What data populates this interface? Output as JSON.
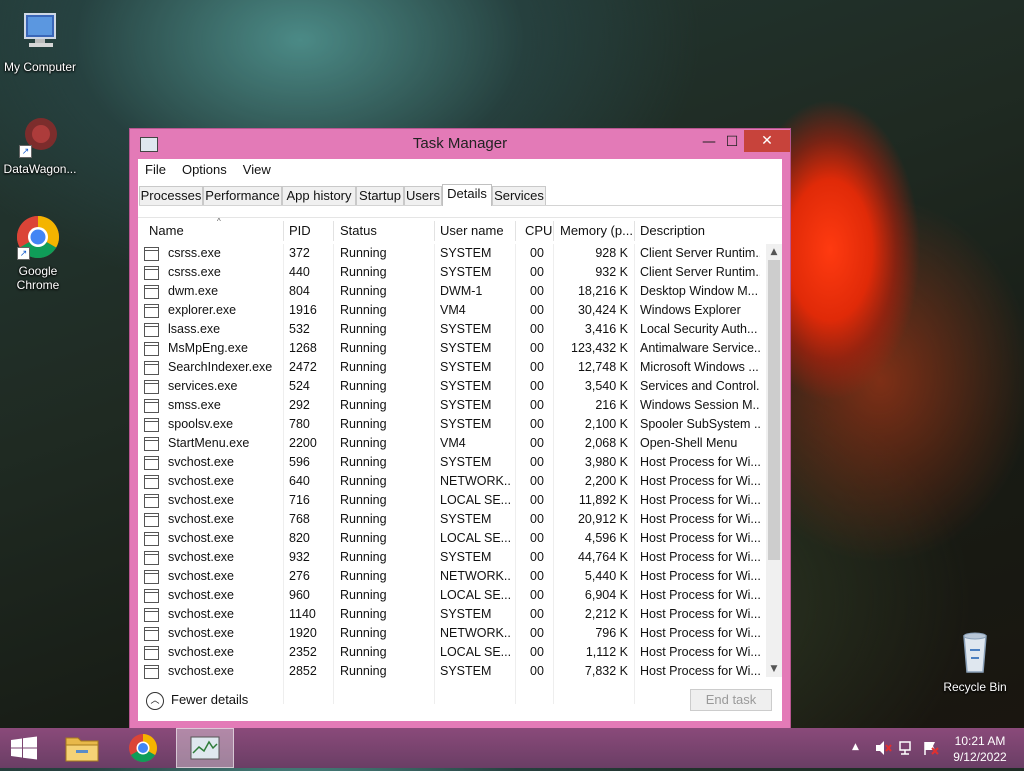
{
  "desktop": {
    "icons": [
      {
        "label": "My Computer"
      },
      {
        "label": "DataWagon..."
      },
      {
        "label": "Google Chrome"
      },
      {
        "label": "Recycle Bin"
      }
    ]
  },
  "window": {
    "title": "Task Manager",
    "controls": {
      "minimize": "—",
      "maximize": "☐",
      "close": "✕"
    },
    "menu": [
      "File",
      "Options",
      "View"
    ],
    "tabs": [
      "Processes",
      "Performance",
      "App history",
      "Startup",
      "Users",
      "Details",
      "Services"
    ],
    "active_tab": "Details",
    "columns": [
      "Name",
      "PID",
      "Status",
      "User name",
      "CPU",
      "Memory (p...",
      "Description"
    ],
    "rows": [
      {
        "name": "csrss.exe",
        "pid": "372",
        "status": "Running",
        "user": "SYSTEM",
        "cpu": "00",
        "mem": "928 K",
        "desc": "Client Server Runtim..."
      },
      {
        "name": "csrss.exe",
        "pid": "440",
        "status": "Running",
        "user": "SYSTEM",
        "cpu": "00",
        "mem": "932 K",
        "desc": "Client Server Runtim..."
      },
      {
        "name": "dwm.exe",
        "pid": "804",
        "status": "Running",
        "user": "DWM-1",
        "cpu": "00",
        "mem": "18,216 K",
        "desc": "Desktop Window M..."
      },
      {
        "name": "explorer.exe",
        "pid": "1916",
        "status": "Running",
        "user": "VM4",
        "cpu": "00",
        "mem": "30,424 K",
        "desc": "Windows Explorer"
      },
      {
        "name": "lsass.exe",
        "pid": "532",
        "status": "Running",
        "user": "SYSTEM",
        "cpu": "00",
        "mem": "3,416 K",
        "desc": "Local Security Auth..."
      },
      {
        "name": "MsMpEng.exe",
        "pid": "1268",
        "status": "Running",
        "user": "SYSTEM",
        "cpu": "00",
        "mem": "123,432 K",
        "desc": "Antimalware Service..."
      },
      {
        "name": "SearchIndexer.exe",
        "pid": "2472",
        "status": "Running",
        "user": "SYSTEM",
        "cpu": "00",
        "mem": "12,748 K",
        "desc": "Microsoft Windows ..."
      },
      {
        "name": "services.exe",
        "pid": "524",
        "status": "Running",
        "user": "SYSTEM",
        "cpu": "00",
        "mem": "3,540 K",
        "desc": "Services and Control..."
      },
      {
        "name": "smss.exe",
        "pid": "292",
        "status": "Running",
        "user": "SYSTEM",
        "cpu": "00",
        "mem": "216 K",
        "desc": "Windows Session M..."
      },
      {
        "name": "spoolsv.exe",
        "pid": "780",
        "status": "Running",
        "user": "SYSTEM",
        "cpu": "00",
        "mem": "2,100 K",
        "desc": "Spooler SubSystem ..."
      },
      {
        "name": "StartMenu.exe",
        "pid": "2200",
        "status": "Running",
        "user": "VM4",
        "cpu": "00",
        "mem": "2,068 K",
        "desc": "Open-Shell Menu"
      },
      {
        "name": "svchost.exe",
        "pid": "596",
        "status": "Running",
        "user": "SYSTEM",
        "cpu": "00",
        "mem": "3,980 K",
        "desc": "Host Process for Wi..."
      },
      {
        "name": "svchost.exe",
        "pid": "640",
        "status": "Running",
        "user": "NETWORK...",
        "cpu": "00",
        "mem": "2,200 K",
        "desc": "Host Process for Wi..."
      },
      {
        "name": "svchost.exe",
        "pid": "716",
        "status": "Running",
        "user": "LOCAL SE...",
        "cpu": "00",
        "mem": "11,892 K",
        "desc": "Host Process for Wi..."
      },
      {
        "name": "svchost.exe",
        "pid": "768",
        "status": "Running",
        "user": "SYSTEM",
        "cpu": "00",
        "mem": "20,912 K",
        "desc": "Host Process for Wi..."
      },
      {
        "name": "svchost.exe",
        "pid": "820",
        "status": "Running",
        "user": "LOCAL SE...",
        "cpu": "00",
        "mem": "4,596 K",
        "desc": "Host Process for Wi..."
      },
      {
        "name": "svchost.exe",
        "pid": "932",
        "status": "Running",
        "user": "SYSTEM",
        "cpu": "00",
        "mem": "44,764 K",
        "desc": "Host Process for Wi..."
      },
      {
        "name": "svchost.exe",
        "pid": "276",
        "status": "Running",
        "user": "NETWORK...",
        "cpu": "00",
        "mem": "5,440 K",
        "desc": "Host Process for Wi..."
      },
      {
        "name": "svchost.exe",
        "pid": "960",
        "status": "Running",
        "user": "LOCAL SE...",
        "cpu": "00",
        "mem": "6,904 K",
        "desc": "Host Process for Wi..."
      },
      {
        "name": "svchost.exe",
        "pid": "1140",
        "status": "Running",
        "user": "SYSTEM",
        "cpu": "00",
        "mem": "2,212 K",
        "desc": "Host Process for Wi..."
      },
      {
        "name": "svchost.exe",
        "pid": "1920",
        "status": "Running",
        "user": "NETWORK...",
        "cpu": "00",
        "mem": "796 K",
        "desc": "Host Process for Wi..."
      },
      {
        "name": "svchost.exe",
        "pid": "2352",
        "status": "Running",
        "user": "LOCAL SE...",
        "cpu": "00",
        "mem": "1,112 K",
        "desc": "Host Process for Wi..."
      },
      {
        "name": "svchost.exe",
        "pid": "2852",
        "status": "Running",
        "user": "SYSTEM",
        "cpu": "00",
        "mem": "7,832 K",
        "desc": "Host Process for Wi..."
      }
    ],
    "footer": {
      "fewer_details": "Fewer details",
      "end_task": "End task"
    }
  },
  "taskbar": {
    "clock_time": "10:21 AM",
    "clock_date": "9/12/2022",
    "pinned": [
      "start-icon",
      "file-explorer-icon",
      "chrome-icon",
      "task-manager-icon"
    ]
  }
}
